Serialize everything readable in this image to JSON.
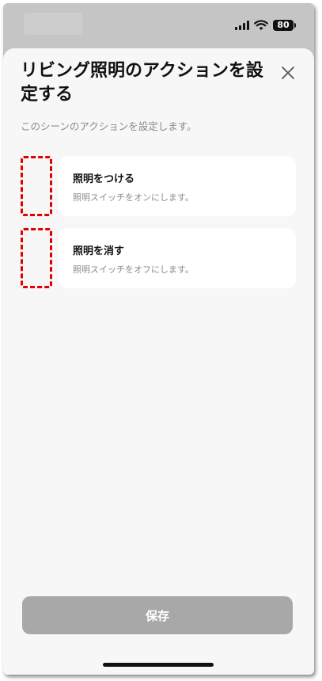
{
  "status_bar": {
    "battery_level": "80"
  },
  "sheet": {
    "title": "リビング照明のアクションを設定する",
    "subtitle": "このシーンのアクションを設定します。",
    "actions": [
      {
        "title": "照明をつける",
        "description": "照明スイッチをオンにします。"
      },
      {
        "title": "照明を消す",
        "description": "照明スイッチをオフにします。"
      }
    ],
    "save_label": "保存"
  },
  "colors": {
    "sheet_background": "#f7f7f7",
    "card_background": "#ffffff",
    "save_button_disabled": "#a8a8a8",
    "highlight_dashed": "#e00000"
  }
}
